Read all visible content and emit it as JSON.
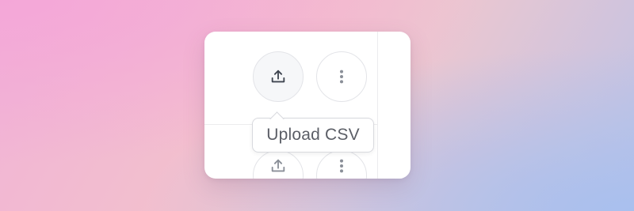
{
  "actions_row": {
    "upload_button": {
      "icon": "upload-icon"
    },
    "more_button": {
      "icon": "more-vertical-icon"
    }
  },
  "tooltip": {
    "text": "Upload CSV"
  },
  "colors": {
    "card_background": "#ffffff",
    "button_border": "#e3e4e8",
    "icon_color": "#3f4550",
    "tooltip_text": "#5b5e66"
  }
}
